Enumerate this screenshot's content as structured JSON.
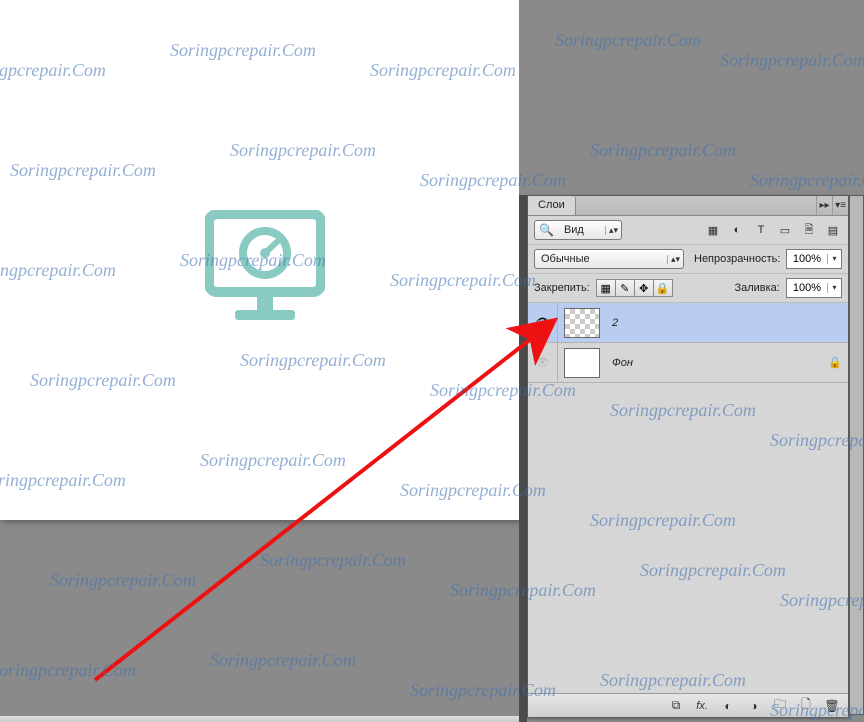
{
  "watermark_text": "Soringpcrepair.Com",
  "panel": {
    "tab_label": "Слои",
    "search": {
      "label": "Вид"
    },
    "type_icons": [
      "image-filter-icon",
      "adjustments-icon",
      "text-icon",
      "shape-icon",
      "smartobject-icon"
    ],
    "blend": {
      "label": "Обычные"
    },
    "opacity": {
      "label": "Непрозрачность:",
      "value": "100%"
    },
    "lock": {
      "label": "Закрепить:"
    },
    "fill": {
      "label": "Заливка:",
      "value": "100%"
    },
    "layers": [
      {
        "name": "2",
        "selected": true,
        "visible": true,
        "thumb": "checker",
        "italic": true,
        "locked": false
      },
      {
        "name": "Фон",
        "selected": false,
        "visible": true,
        "thumb": "white",
        "italic": true,
        "locked": true
      }
    ],
    "footer_icons": [
      "link-icon",
      "fx-icon",
      "mask-icon",
      "adjustment-icon",
      "group-icon",
      "new-layer-icon",
      "trash-icon"
    ]
  },
  "glyphs": {
    "collapse": "▸▸",
    "menu": "▾≡",
    "updown": "▴▾",
    "magnifier": "🔍",
    "image": "▦",
    "circle": "◐",
    "text_t": "T",
    "shape": "▭",
    "smart": "🗎",
    "eye": "👁",
    "lock": "🔒",
    "pixels": "▦",
    "brush": "✎",
    "move": "✥",
    "lock2": "🔒",
    "link": "⧉",
    "fx": "fx.",
    "mask": "◐",
    "adjust": "◑",
    "group": "🗀",
    "newlayer": "🗋",
    "trash": "🗑",
    "dropdown": "▾",
    "panel_menu": "▤"
  }
}
